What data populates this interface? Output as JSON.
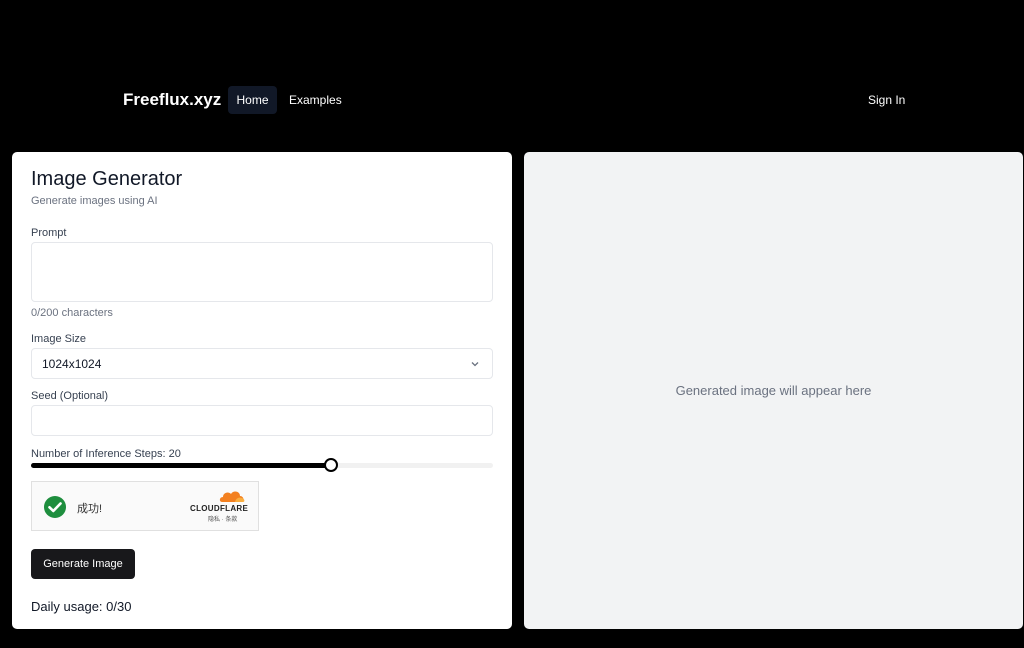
{
  "nav": {
    "brand": "Freeflux.xyz",
    "home": "Home",
    "examples": "Examples",
    "sign_in": "Sign In"
  },
  "form": {
    "title": "Image Generator",
    "subtitle": "Generate images using AI",
    "prompt_label": "Prompt",
    "prompt_value": "",
    "char_count": "0/200 characters",
    "size_label": "Image Size",
    "size_value": "1024x1024",
    "seed_label": "Seed (Optional)",
    "seed_value": "",
    "steps_label": "Number of Inference Steps: 20",
    "steps_value": 20,
    "steps_fraction": 0.65,
    "generate_button": "Generate Image",
    "daily_usage": "Daily usage: 0/30"
  },
  "captcha": {
    "status_text": "成功!",
    "provider": "CLOUDFLARE",
    "links": "隐私 · 条款",
    "icon": "check-circle-icon",
    "status_color": "#1e8e3e",
    "brand_color": "#f38020"
  },
  "preview": {
    "placeholder": "Generated image will appear here"
  },
  "colors": {
    "background": "#000000",
    "card": "#ffffff",
    "preview_bg": "#f2f3f4",
    "button": "#18181b",
    "nav_active": "#111827"
  }
}
